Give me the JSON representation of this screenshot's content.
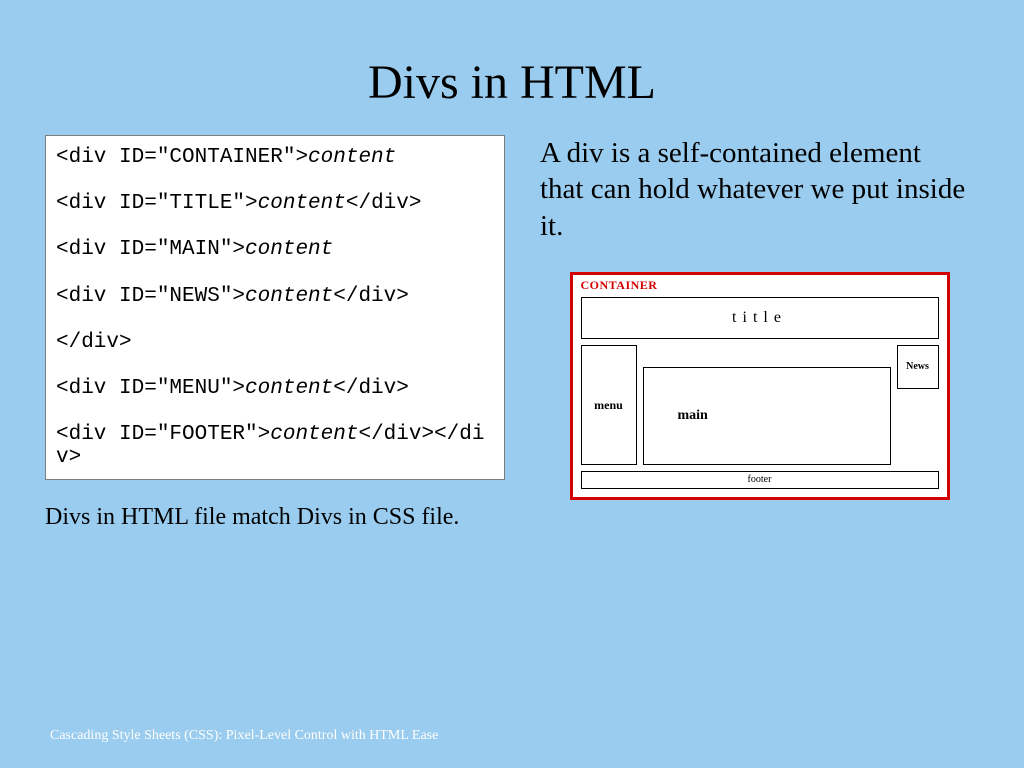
{
  "title": "Divs in HTML",
  "code": {
    "l1a": "<div ID=\"CONTAINER\">",
    "l1b": "content",
    "l2a": "<div ID=\"TITLE\">",
    "l2b": "content",
    "l2c": "</div>",
    "l3a": "<div ID=\"MAIN\">",
    "l3b": "content",
    "l4a": "<div ID=\"NEWS\">",
    "l4b": "content",
    "l4c": "</div>",
    "l5": "</div>",
    "l6a": "<div ID=\"MENU\">",
    "l6b": "content",
    "l6c": "</div>",
    "l7a": "<div ID=\"FOOTER\">",
    "l7b": "content",
    "l7c": "</div></div>"
  },
  "caption": "Divs in HTML file match Divs in CSS file.",
  "body": "A div is a self-contained element that can hold whatever we put inside it.",
  "diagram": {
    "container": "CONTAINER",
    "title": "title",
    "menu": "menu",
    "main": "main",
    "news": "News",
    "footer": "footer"
  },
  "footer": "Cascading Style Sheets (CSS): Pixel-Level Control with HTML Ease"
}
